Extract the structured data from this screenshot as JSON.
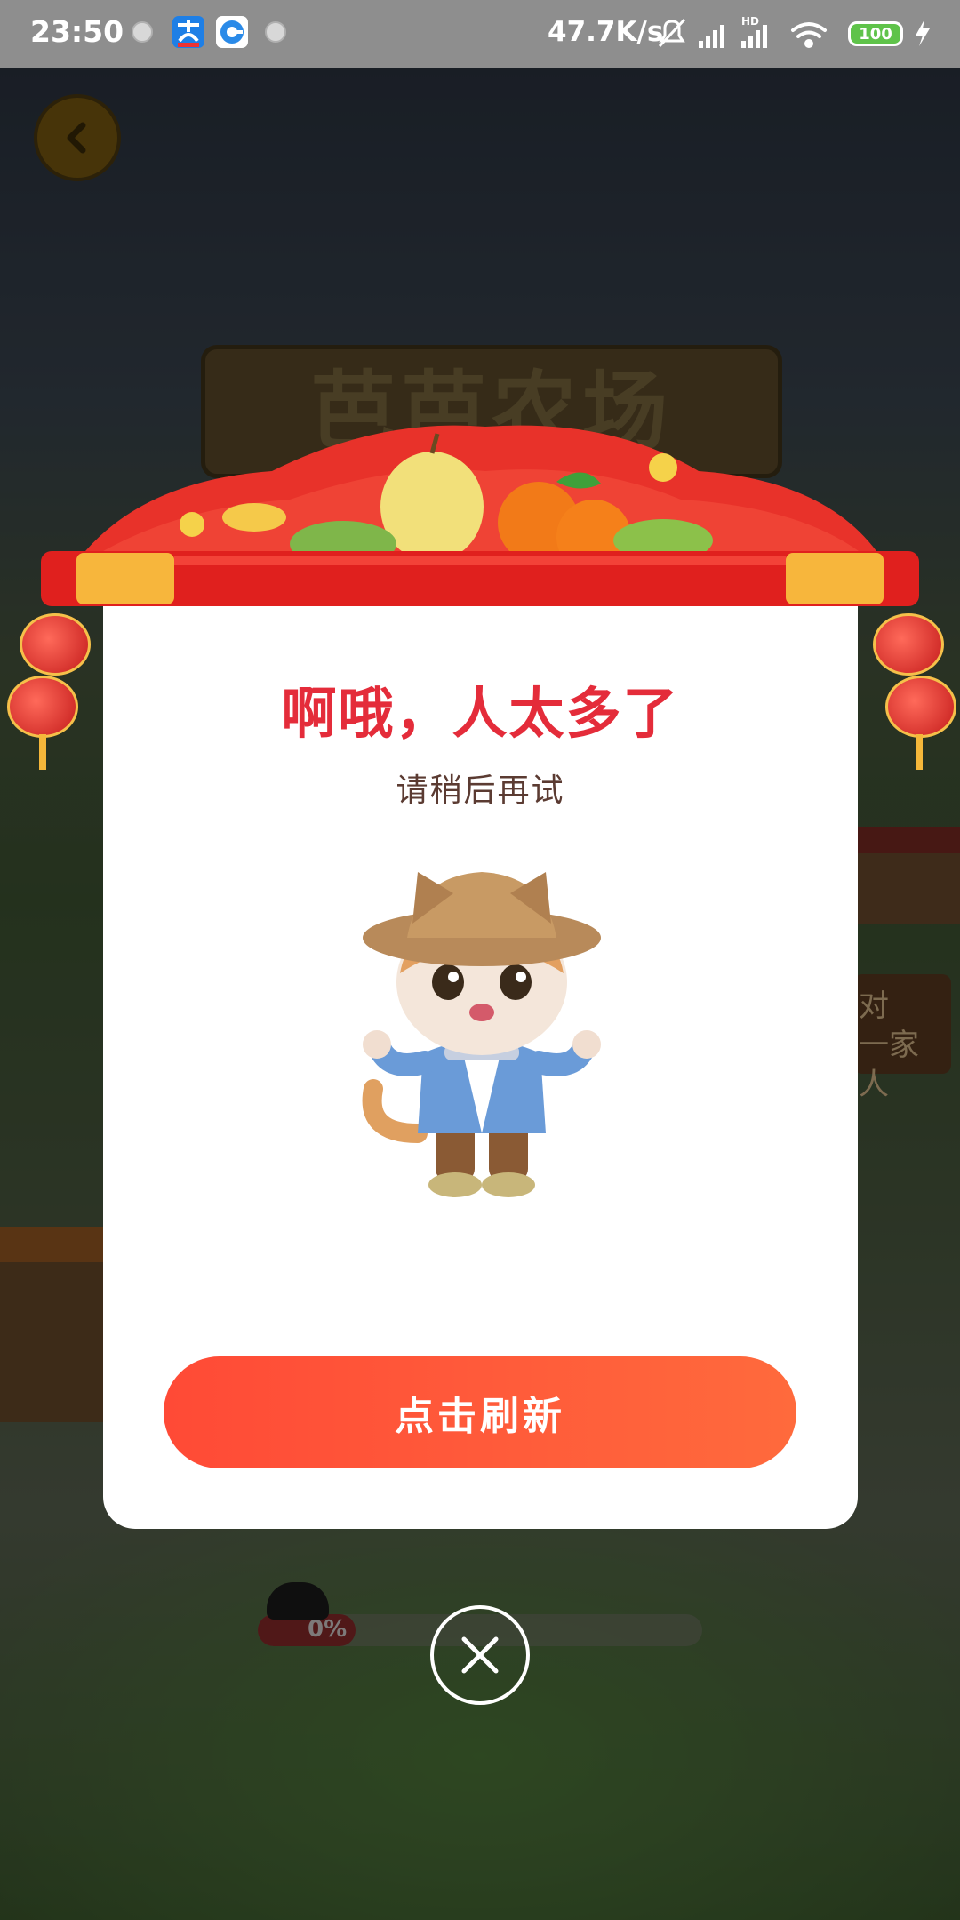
{
  "status_bar": {
    "time": "23:50",
    "net_speed": "47.7K/s",
    "battery": "100",
    "hd_label": "HD"
  },
  "background": {
    "farm_title": "芭芭农场",
    "side_sign_line1": "对",
    "side_sign_line2": "一家人",
    "progress_label": "0%",
    "progress_value": 0
  },
  "dialog": {
    "title": "啊哦，人太多了",
    "subtitle": "请稍后再试",
    "refresh_label": "点击刷新"
  },
  "colors": {
    "title": "#e42c3a",
    "button": "#ff5a3a",
    "status_bar": "#8e8e8e"
  }
}
